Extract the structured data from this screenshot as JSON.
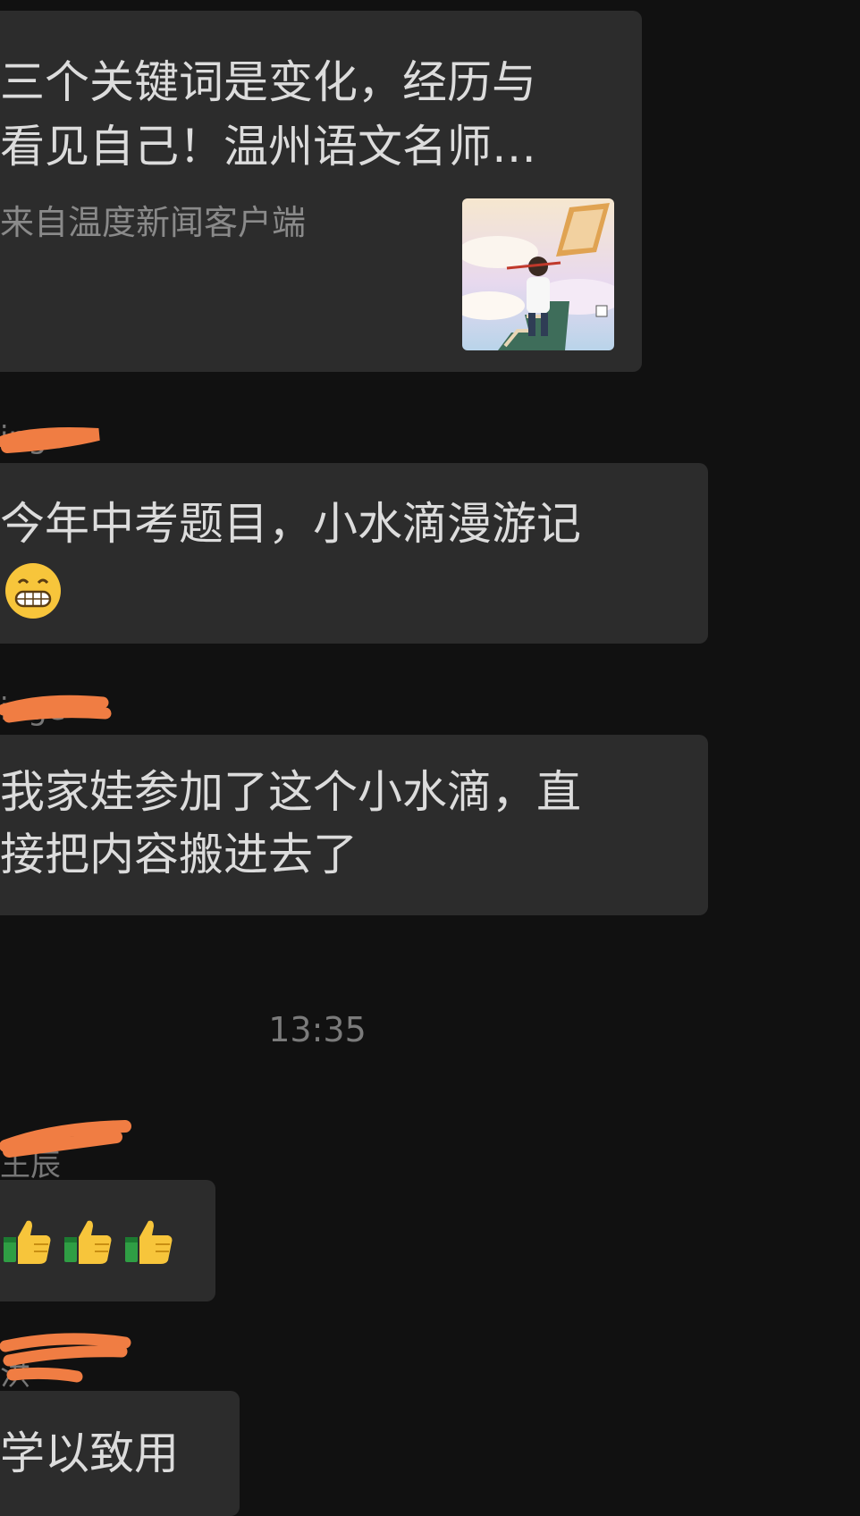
{
  "messages": [
    {
      "type": "link",
      "title_lines": [
        "三个关键词是变化，经历与",
        "看见自己！温州语文名师…"
      ],
      "source": "来自温度新闻客户端",
      "thumbnail": "article-thumbnail-boy-on-book-stairs"
    },
    {
      "sender": "inge",
      "lines": [
        "今年中考题目，小水滴漫游记"
      ],
      "trailing_emoji": "grinning-face"
    },
    {
      "sender": "inge",
      "lines": [
        "我家娃参加了这个小水滴，直",
        "接把内容搬进去了"
      ]
    },
    {
      "timestamp": "13:35"
    },
    {
      "sender": "王辰",
      "emoji": [
        "thumbs-up",
        "thumbs-up",
        "thumbs-up"
      ]
    },
    {
      "sender": "洪",
      "lines": [
        "学以致用"
      ]
    }
  ],
  "colors": {
    "background": "#111111",
    "bubble": "#2c2c2c",
    "text": "#dcdcdc",
    "muted": "#8a8a8a",
    "redaction": "#f07d43"
  }
}
